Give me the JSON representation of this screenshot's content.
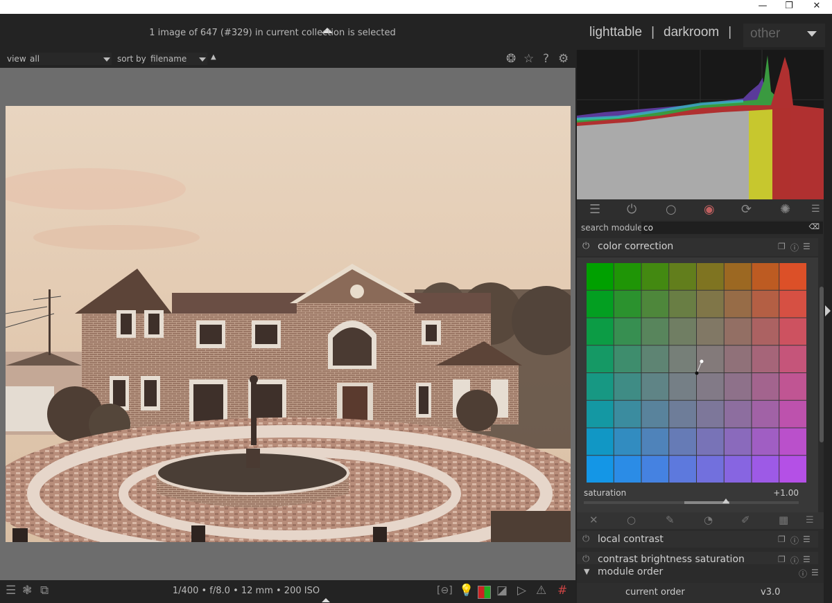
{
  "window": {
    "minimize": "—",
    "restore": "❐",
    "close": "✕"
  },
  "header": {
    "selection_text": "1 image of 647 (#329) in current collection is selected",
    "views": {
      "lighttable": "lighttable",
      "darkroom": "darkroom",
      "other": "other",
      "separator": "|"
    }
  },
  "filterbar": {
    "view_label": "view",
    "view_value": "all",
    "sort_label": "sort by",
    "sort_value": "filename",
    "sort_dir_icon": "▲"
  },
  "toolbar_icons": [
    "grouping-icon",
    "star-icon",
    "help-icon",
    "gear-icon"
  ],
  "module_groups": [
    "sliders-icon",
    "power-icon",
    "circle-icon",
    "color-wheel-icon",
    "correct-icon",
    "effect-icon",
    "menu-icon"
  ],
  "search": {
    "label": "search module",
    "value": "co"
  },
  "color_correction": {
    "title": "color correction",
    "saturation_label": "saturation",
    "saturation_value": "+1.00",
    "saturation_level": 0.5
  },
  "mask_icons": [
    "off-icon",
    "uniform-icon",
    "drawn-icon",
    "parametric-icon",
    "drawn-parametric-icon",
    "raster-icon",
    "menu-icon"
  ],
  "modules": [
    {
      "name": "local contrast"
    },
    {
      "name": "contrast brightness saturation"
    }
  ],
  "module_order": {
    "title": "module order",
    "current_label": "current order",
    "current_value": "v3.0"
  },
  "bottombar": {
    "exif": "1/400 • f/8.0 • 12 mm • 200 ISO"
  },
  "colors": {
    "bg": "#222222",
    "panel": "#2b2b2b",
    "center": "#6d6d6d",
    "sepia_sky": "#e8d5c0",
    "brick": "#8a6a58"
  }
}
